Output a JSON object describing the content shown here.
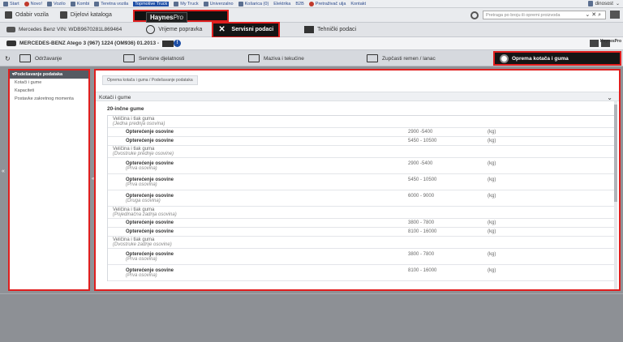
{
  "topbar": {
    "items": [
      {
        "label": "Start"
      },
      {
        "label": "Novo!"
      },
      {
        "label": "Vozilo"
      },
      {
        "label": "Kombi"
      },
      {
        "label": "Teretna vozila"
      },
      {
        "label": "Topmotive Truck"
      },
      {
        "label": "My Truck"
      },
      {
        "label": "Univerzalno"
      },
      {
        "label": "Košarica (0)"
      },
      {
        "label": "Elektrika"
      },
      {
        "label": "B2B"
      },
      {
        "label": "Pretraživač ulja"
      },
      {
        "label": "Kontakt"
      }
    ],
    "user": "dinosost"
  },
  "toolbar": {
    "odabir": "Odabir vozila",
    "katalog": "Dijelovi kataloga",
    "haynes_brand": "Haynes",
    "haynes_pro": "Pro",
    "search_placeholder": "Pretraga po broju ili opremi proizvoda"
  },
  "vehicle_bar": {
    "vin": "Mercedes Benz VIN: WDB9670281L869464",
    "tab_time": "Vrijeme popravka",
    "tab_service": "Servisni podaci",
    "tab_technical": "Tehnički podaci"
  },
  "vehicle": {
    "name": "MERCEDES-BENZ Atego 3 (967) 1224 (OM936) 01.2013 -",
    "brand": "HaynesPro"
  },
  "nav": {
    "maintenance": "Održavanje",
    "service": "Servisne djelatnosti",
    "fluids": "Maziva i tekućine",
    "belt": "Zupčasti remen / lanac",
    "wheels": "Oprema kotača i guma"
  },
  "sidebar": {
    "header": "Podešavanje podataka",
    "items": [
      "Kotači i gume",
      "Kapaciteti",
      "Postavke zakretnog momenta"
    ]
  },
  "content": {
    "breadcrumb": "Oprema kotača i guma / Podešavanje podataka",
    "section": "Kotači i gume",
    "subheader": "20-inčne gume",
    "groups": [
      {
        "title": "Veličina i tlak guma",
        "subtitle": "(Jedna prednja osovina)",
        "rows": [
          {
            "label": "Opterećenje osovine",
            "value": "2900 -5400",
            "unit": "(kg)",
            "sub": ""
          },
          {
            "label": "Opterećenje osovine",
            "value": "5450 - 10500",
            "unit": "(kg)",
            "sub": ""
          }
        ]
      },
      {
        "title": "Veličina i tlak guma",
        "subtitle": "(Dvostruke prednje osovine)",
        "rows": [
          {
            "label": "Opterećenje osovine",
            "value": "2900 -5400",
            "unit": "(kg)",
            "sub": "(Prva osovina)"
          },
          {
            "label": "Opterećenje osovine",
            "value": "5450 - 10500",
            "unit": "(kg)",
            "sub": "(Prva osovina)"
          },
          {
            "label": "Opterećenje osovine",
            "value": "6000 - 9000",
            "unit": "(kg)",
            "sub": "(Druga osovina)"
          }
        ]
      },
      {
        "title": "Veličina i tlak guma",
        "subtitle": "(Pojedinačna zadnja osovina)",
        "rows": [
          {
            "label": "Opterećenje osovine",
            "value": "3800 - 7800",
            "unit": "(kg)",
            "sub": ""
          },
          {
            "label": "Opterećenje osovine",
            "value": "8100 - 16000",
            "unit": "(kg)",
            "sub": ""
          }
        ]
      },
      {
        "title": "Veličina i tlak guma",
        "subtitle": "(Dvostruke zadnje osovine)",
        "rows": [
          {
            "label": "Opterećenje osovine",
            "value": "3800 - 7800",
            "unit": "(kg)",
            "sub": "(Prva osovina)"
          },
          {
            "label": "Opterećenje osovine",
            "value": "8100 - 16000",
            "unit": "(kg)",
            "sub": "(Prva osovina)"
          }
        ]
      }
    ]
  }
}
